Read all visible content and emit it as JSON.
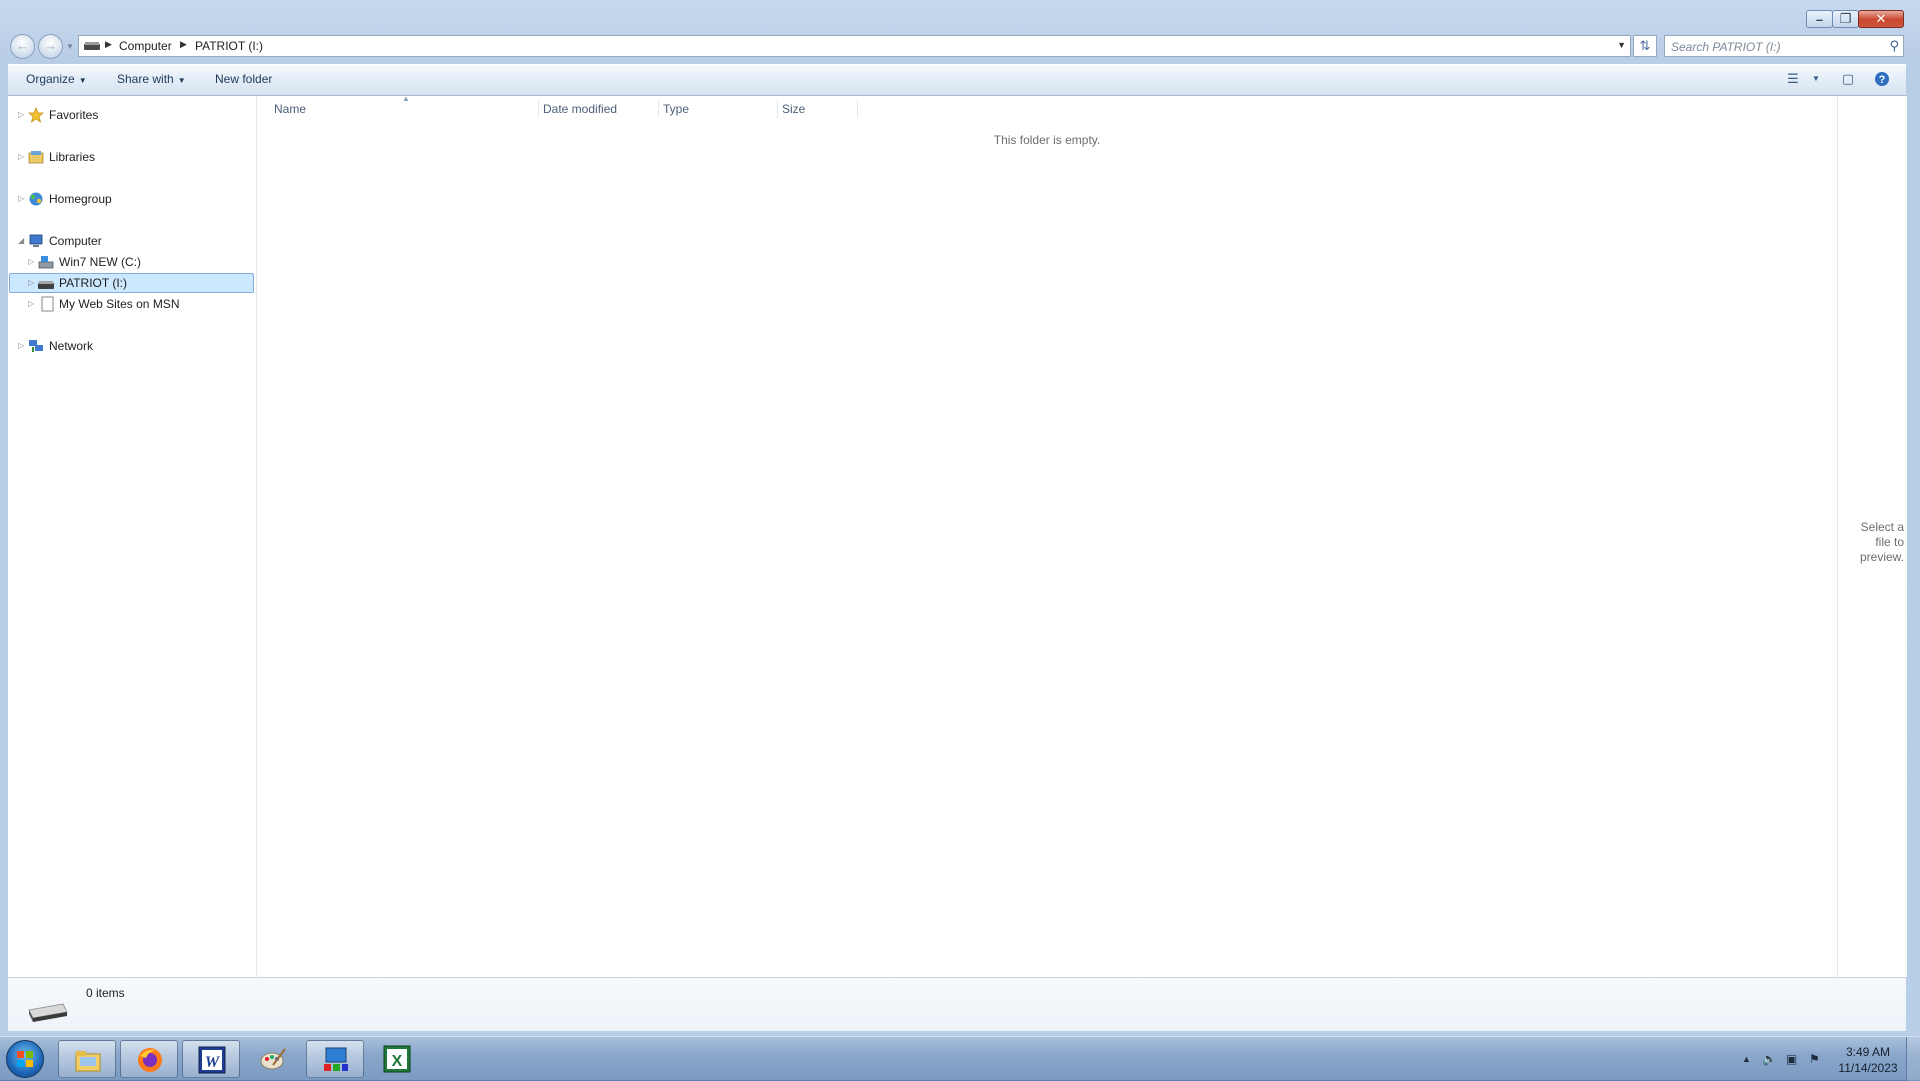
{
  "window": {
    "address": {
      "crumbs": [
        "Computer",
        "PATRIOT (I:)"
      ]
    },
    "search": {
      "placeholder": "Search PATRIOT (I:)"
    }
  },
  "toolbar": {
    "organize": "Organize",
    "share_with": "Share with",
    "new_folder": "New folder"
  },
  "navpane": {
    "favorites": "Favorites",
    "libraries": "Libraries",
    "homegroup": "Homegroup",
    "computer": "Computer",
    "drive_c": "Win7 NEW (C:)",
    "drive_i": "PATRIOT (I:)",
    "msn": "My Web Sites on MSN",
    "network": "Network"
  },
  "filelist": {
    "columns": [
      "Name",
      "Date modified",
      "Type",
      "Size"
    ],
    "empty_message": "This folder is empty."
  },
  "preview": {
    "text": "Select a file to preview."
  },
  "details": {
    "item_count": "0 items"
  },
  "taskbar": {
    "apps": [
      "windows-explorer",
      "firefox",
      "word",
      "paint",
      "control-panel",
      "excel"
    ],
    "time": "3:49 AM",
    "date": "11/14/2023"
  },
  "colors": {
    "accent": "#3399ff",
    "selection": "#cce8ff",
    "close": "#c8462f"
  }
}
